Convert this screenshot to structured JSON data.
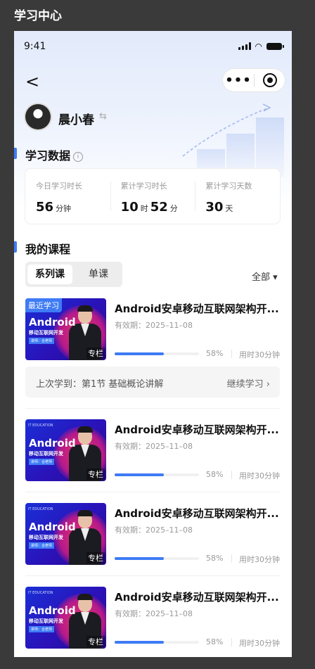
{
  "header": {
    "title": "学习中心"
  },
  "status_bar": {
    "time": "9:41"
  },
  "nav": {
    "back_glyph": "<",
    "more_glyph": "•••"
  },
  "user": {
    "name": "晨小春"
  },
  "study_data": {
    "title": "学习数据",
    "info_glyph": "i",
    "stats": [
      {
        "label": "今日学习时长",
        "value1": "56",
        "unit1": "分钟",
        "value2": "",
        "unit2": ""
      },
      {
        "label": "累计学习时长",
        "value1": "10",
        "unit1": "时",
        "value2": "52",
        "unit2": "分"
      },
      {
        "label": "累计学习天数",
        "value1": "30",
        "unit1": "天",
        "value2": "",
        "unit2": ""
      }
    ]
  },
  "my_courses": {
    "title": "我的课程",
    "tabs": [
      "系列课",
      "单课"
    ],
    "filter": "全部 ▾",
    "recent_badge": "最近学习",
    "courses": [
      {
        "title": "Android安卓移动互联网架构开...",
        "valid": "有效期：2025–11–08",
        "progress_pct": 58,
        "progress_label": "58%",
        "time_used": "用时30分钟"
      },
      {
        "title": "Android安卓移动互联网架构开...",
        "valid": "有效期：2025–11–08",
        "progress_pct": 58,
        "progress_label": "58%",
        "time_used": "用时30分钟"
      },
      {
        "title": "Android安卓移动互联网架构开...",
        "valid": "有效期：2025–11–08",
        "progress_pct": 58,
        "progress_label": "58%",
        "time_used": "用时30分钟"
      },
      {
        "title": "Android安卓移动互联网架构开...",
        "valid": "有效期：2025–11–08",
        "progress_pct": 58,
        "progress_label": "58%",
        "time_used": "用时30分钟"
      }
    ],
    "thumb": {
      "top_text": "IT EDUCATION",
      "main": "Android",
      "sub": "移动互联网开发",
      "tag": "讲师：合老师",
      "corner": "专栏"
    },
    "last_study": {
      "text": "上次学到：第1节 基础概论讲解",
      "action": "继续学习 ›"
    }
  },
  "colors": {
    "accent": "#3e7bf5"
  }
}
